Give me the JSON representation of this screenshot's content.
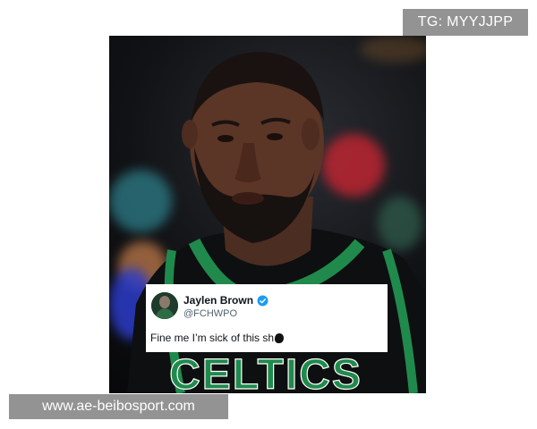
{
  "watermarks": {
    "top": "TG: MYYJJPP",
    "bottom": "www.ae-beibosport.com"
  },
  "tweet": {
    "name": "Jaylen Brown",
    "handle": "@FCHWPO",
    "text": "Fine me I’m sick of this sh"
  },
  "jersey": {
    "text": "CELTICS"
  },
  "colors": {
    "jersey_green": "#1f8a4c",
    "jersey_black": "#0e0f10",
    "verified_blue": "#1d9bf0"
  },
  "icons": {
    "verified": "verified-badge-icon",
    "censor": "censor-emoji-icon"
  }
}
